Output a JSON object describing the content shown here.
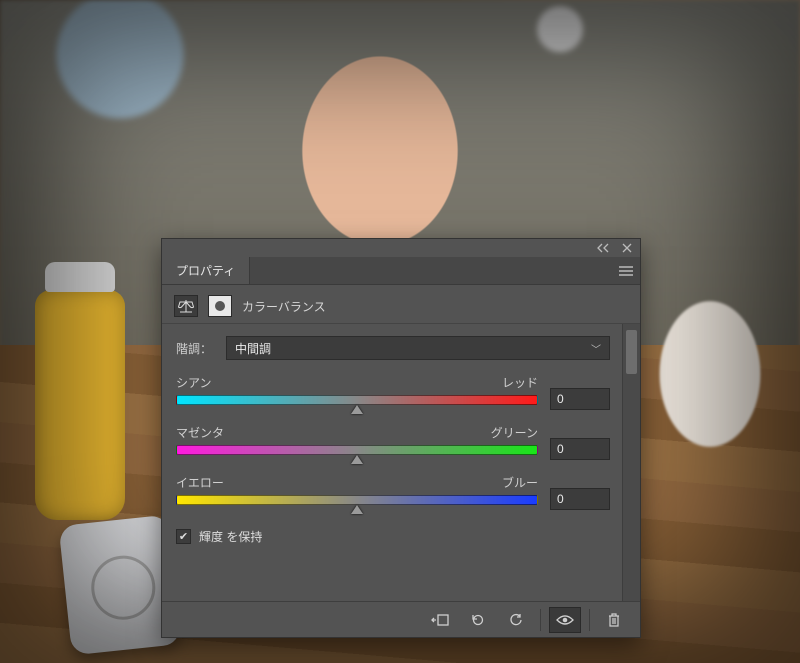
{
  "panel": {
    "title_tab": "プロパティ",
    "adjustment_name": "カラーバランス",
    "tone_label": "階調：",
    "tone_selected": "中間調",
    "preserve_luminosity_label": "輝度 を保持",
    "preserve_luminosity_checked": true
  },
  "sliders": {
    "cyan_red": {
      "left": "シアン",
      "right": "レッド",
      "value": "0"
    },
    "magenta_green": {
      "left": "マゼンタ",
      "right": "グリーン",
      "value": "0"
    },
    "yellow_blue": {
      "left": "イエロー",
      "right": "ブルー",
      "value": "0"
    }
  },
  "footer_icons": {
    "clip": "clip-to-layer-icon",
    "prev": "view-previous-state-icon",
    "reset": "reset-icon",
    "visibility": "visibility-icon",
    "delete": "trash-icon"
  }
}
